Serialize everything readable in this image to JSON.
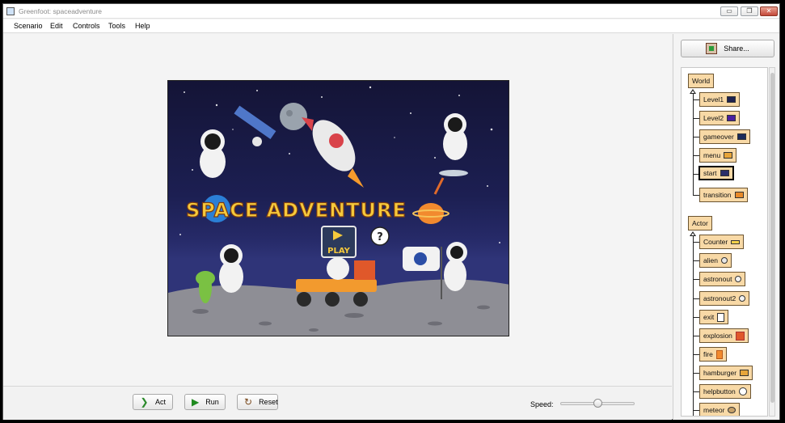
{
  "window": {
    "title": "Greenfoot: spaceadventure"
  },
  "window_buttons": {
    "minimize": "▭",
    "maximize": "❐",
    "close": "✕"
  },
  "menu": [
    "Scenario",
    "Edit",
    "Controls",
    "Tools",
    "Help"
  ],
  "world": {
    "game_title": "SPACE ADVENTURE",
    "play_label": "PLAY",
    "help_glyph": "?"
  },
  "controls": {
    "act_label": "Act",
    "run_label": "Run",
    "reset_label": "Reset",
    "speed_label": "Speed:",
    "speed_fraction": 0.5
  },
  "sidebar": {
    "share_label": "Share...",
    "world_root": "World",
    "world_classes": [
      "Level1",
      "Level2",
      "gameover",
      "menu",
      "start",
      "transition"
    ],
    "selected_class": "start",
    "actor_root": "Actor",
    "actor_classes": [
      "Counter",
      "alien",
      "astronout",
      "astronout2",
      "exit",
      "explosion",
      "fire",
      "hamburger",
      "helpbutton",
      "meteor"
    ]
  },
  "colors": {
    "class_fill": "#f8d9a6",
    "class_border": "#6b5431",
    "sky": "#1c1f52",
    "title_yellow": "#f6c93b",
    "close_red": "#c4493a"
  },
  "icons": {
    "act": "step-icon",
    "run": "play-icon",
    "reset": "reset-icon",
    "share": "share-icon"
  }
}
